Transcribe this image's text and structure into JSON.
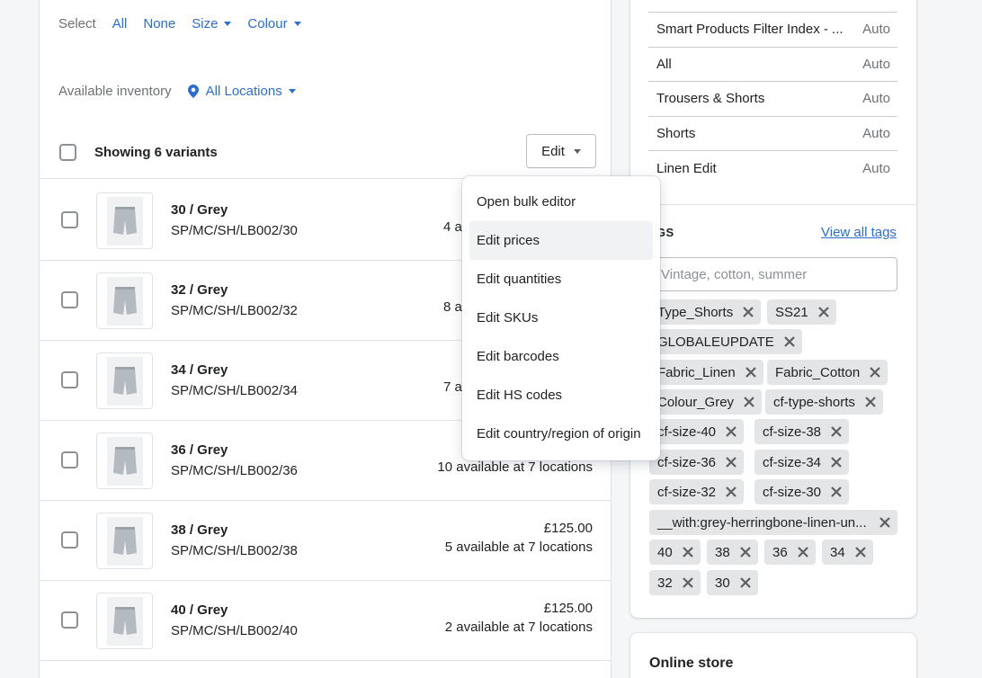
{
  "filters": {
    "select_label": "Select",
    "all": "All",
    "none": "None",
    "size": "Size",
    "colour": "Colour",
    "inventory_label": "Available inventory",
    "locations": "All Locations"
  },
  "variants_header": {
    "title": "Showing 6 variants",
    "edit_label": "Edit"
  },
  "variants": [
    {
      "name": "30 / Grey",
      "sku": "SP/MC/SH/LB002/30",
      "price": "",
      "availability": "4 a"
    },
    {
      "name": "32 / Grey",
      "sku": "SP/MC/SH/LB002/32",
      "price": "",
      "availability": "8 a"
    },
    {
      "name": "34 / Grey",
      "sku": "SP/MC/SH/LB002/34",
      "price": "",
      "availability": "7 a"
    },
    {
      "name": "36 / Grey",
      "sku": "SP/MC/SH/LB002/36",
      "price": "",
      "availability": "10 available at 7 locations"
    },
    {
      "name": "38 / Grey",
      "sku": "SP/MC/SH/LB002/38",
      "price": "£125.00",
      "availability": "5 available at 7 locations"
    },
    {
      "name": "40 / Grey",
      "sku": "SP/MC/SH/LB002/40",
      "price": "£125.00",
      "availability": "2 available at 7 locations"
    }
  ],
  "edit_menu": [
    "Open bulk editor",
    "Edit prices",
    "Edit quantities",
    "Edit SKUs",
    "Edit barcodes",
    "Edit HS codes",
    "Edit country/region of origin"
  ],
  "collections": [
    {
      "name": "Smart Products Filter Index - ...",
      "type": "Auto"
    },
    {
      "name": "All",
      "type": "Auto"
    },
    {
      "name": "Trousers & Shorts",
      "type": "Auto"
    },
    {
      "name": "Shorts",
      "type": "Auto"
    },
    {
      "name": "Linen Edit",
      "type": "Auto"
    }
  ],
  "tags": {
    "title": "AGS",
    "view_all": "View all tags",
    "placeholder": "Vintage, cotton, summer",
    "items": [
      "Type_Shorts",
      "SS21",
      "GLOBALEUPDATE",
      "Fabric_Linen",
      "Fabric_Cotton",
      "Colour_Grey",
      "cf-type-shorts",
      "cf-size-40",
      "cf-size-38",
      "cf-size-36",
      "cf-size-34",
      "cf-size-32",
      "cf-size-30",
      "__with:grey-herringbone-linen-un...",
      "40",
      "38",
      "36",
      "34",
      "32",
      "30"
    ]
  },
  "online_store": {
    "title": "Online store"
  },
  "colors": {
    "link": "#2c6ecb",
    "tag_bg": "#e4e5e7",
    "highlight": "#f1f2f3"
  }
}
